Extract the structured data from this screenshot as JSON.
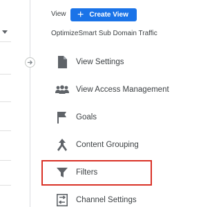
{
  "view": {
    "label": "View",
    "create_button": "Create View",
    "selected": "OptimizeSmart Sub Domain Traffic"
  },
  "menu": [
    {
      "label": "View Settings",
      "icon": "document-icon"
    },
    {
      "label": "View Access Management",
      "icon": "people-icon"
    },
    {
      "label": "Goals",
      "icon": "flag-icon"
    },
    {
      "label": "Content Grouping",
      "icon": "content-grouping-icon"
    },
    {
      "label": "Filters",
      "icon": "filter-icon",
      "highlighted": true
    },
    {
      "label": "Channel Settings",
      "icon": "channel-settings-icon"
    }
  ],
  "colors": {
    "accent": "#1a73e8",
    "highlight": "#d93025",
    "icon": "#5f6368"
  }
}
